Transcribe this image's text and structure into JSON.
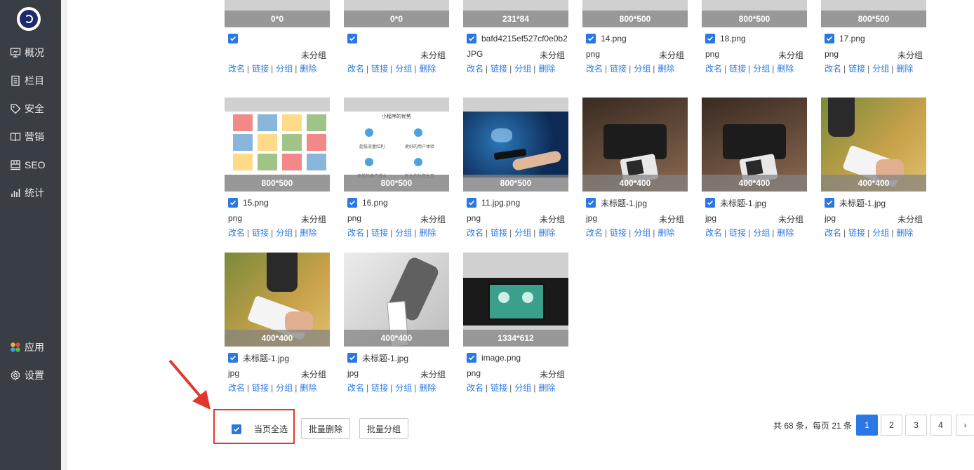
{
  "sidebar": {
    "items": [
      {
        "label": "概况",
        "icon": "monitor-icon"
      },
      {
        "label": "栏目",
        "icon": "document-icon"
      },
      {
        "label": "安全",
        "icon": "tag-icon"
      },
      {
        "label": "营销",
        "icon": "book-icon"
      },
      {
        "label": "SEO",
        "icon": "seo-icon"
      },
      {
        "label": "统计",
        "icon": "bar-chart-icon"
      },
      {
        "label": "应用",
        "icon": "apps-icon"
      },
      {
        "label": "设置",
        "icon": "gear-icon"
      }
    ]
  },
  "actions": {
    "rename": "改名",
    "link": "链接",
    "group": "分组",
    "delete": "删除",
    "separator": "|"
  },
  "cards": [
    {
      "dim": "0*0",
      "name": "",
      "type": "",
      "group": "未分组"
    },
    {
      "dim": "0*0",
      "name": "",
      "type": "",
      "group": "未分组"
    },
    {
      "dim": "231*84",
      "name": "bafd4215ef527cf0e0b2",
      "type": "JPG",
      "group": "未分组"
    },
    {
      "dim": "800*500",
      "name": "14.png",
      "type": "png",
      "group": "未分组"
    },
    {
      "dim": "800*500",
      "name": "18.png",
      "type": "png",
      "group": "未分组"
    },
    {
      "dim": "800*500",
      "name": "17.png",
      "type": "png",
      "group": "未分组"
    },
    {
      "dim": "800*500",
      "name": "15.png",
      "type": "png",
      "group": "未分组"
    },
    {
      "dim": "800*500",
      "name": "16.png",
      "type": "png",
      "group": "未分组"
    },
    {
      "dim": "800*500",
      "name": "11.jpg.png",
      "type": "png",
      "group": "未分组"
    },
    {
      "dim": "400*400",
      "name": "未标题-1.jpg",
      "type": "jpg",
      "group": "未分组"
    },
    {
      "dim": "400*400",
      "name": "未标题-1.jpg",
      "type": "jpg",
      "group": "未分组"
    },
    {
      "dim": "400*400",
      "name": "未标题-1.jpg",
      "type": "jpg",
      "group": "未分组"
    },
    {
      "dim": "400*400",
      "name": "未标题-1.jpg",
      "type": "jpg",
      "group": "未分组"
    },
    {
      "dim": "400*400",
      "name": "未标题-1.jpg",
      "type": "jpg",
      "group": "未分组"
    },
    {
      "dim": "1334*612",
      "name": "image.png",
      "type": "png",
      "group": "未分组"
    }
  ],
  "thumb_text": {
    "card7_title": "小程序的优势",
    "card7_items": [
      "超低流量红利",
      "更好的用户体验",
      "更低的推广成本",
      "新生的社交生态"
    ]
  },
  "bottom": {
    "select_all": "当页全选",
    "batch_delete": "批量删除",
    "batch_group": "批量分组"
  },
  "pager": {
    "info": "共 68 条，每页 21 条",
    "pages": [
      "1",
      "2",
      "3",
      "4"
    ],
    "current": "1",
    "next": "›"
  },
  "colors": {
    "accent": "#2a78e4",
    "sidebar": "#393d44",
    "highlight": "#e0382e"
  }
}
